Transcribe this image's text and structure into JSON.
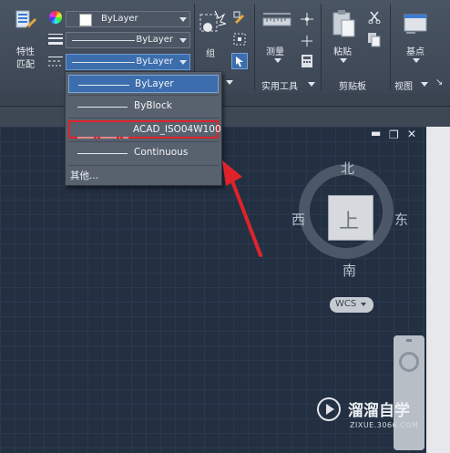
{
  "ribbon": {
    "match_label_line1": "特性",
    "match_label_line2": "匹配",
    "color_combo": "ByLayer",
    "linetype_combo": "ByLayer",
    "lineweight_combo": "ByLayer",
    "group_label": "组",
    "measure_label": "测量",
    "utilities_panel": "实用工具",
    "paste_label": "粘贴",
    "clipboard_panel": "剪贴板",
    "basepoint_label": "基点",
    "view_panel": "视图"
  },
  "linetype_dropdown": {
    "items": [
      {
        "label": "ByLayer",
        "selected": true
      },
      {
        "label": "ByBlock",
        "selected": false
      },
      {
        "label": "ACAD_ISO04W100",
        "selected": false,
        "highlighted_box": true
      },
      {
        "label": "Continuous",
        "selected": false
      }
    ],
    "other": "其他..."
  },
  "viewcube": {
    "north": "北",
    "south": "南",
    "east": "东",
    "west": "西",
    "top_face": "上",
    "wcs": "WCS"
  },
  "watermark": {
    "brand": "溜溜自学",
    "url": "ZIXUE.3066.COM"
  },
  "colors": {
    "canvas": "#233042",
    "selection": "#3c6dad",
    "highlight_box": "#e0232b",
    "arrow": "#e0232b"
  }
}
